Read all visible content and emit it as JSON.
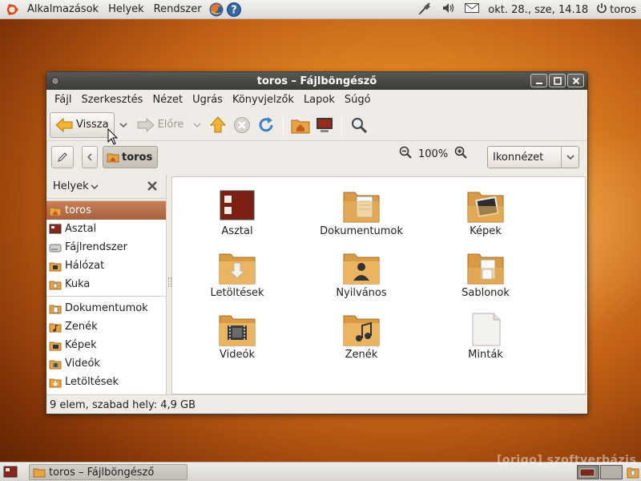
{
  "panel": {
    "menus": [
      "Alkalmazások",
      "Helyek",
      "Rendszer"
    ],
    "clock": "okt. 28., sze, 14.18",
    "user": "toros"
  },
  "window": {
    "title": "toros – Fájlböngésző",
    "menu": [
      "Fájl",
      "Szerkesztés",
      "Nézet",
      "Ugrás",
      "Könyvjelzők",
      "Lapok",
      "Súgó"
    ],
    "toolbar": {
      "back": "Vissza",
      "forward": "Előre"
    },
    "location": {
      "path": "toros",
      "zoom": "100%",
      "view": "Ikonnézet"
    },
    "sidebar": {
      "header": "Helyek",
      "places": [
        "toros",
        "Asztal",
        "Fájlrendszer",
        "Hálózat",
        "Kuka"
      ],
      "bookmarks": [
        "Dokumentumok",
        "Zenék",
        "Képek",
        "Videók",
        "Letöltések"
      ]
    },
    "files": [
      "Asztal",
      "Dokumentumok",
      "Képek",
      "Letöltések",
      "Nyilvános",
      "Sablonok",
      "Videók",
      "Zenék",
      "Minták"
    ],
    "status": "9 elem, szabad hely: 4,9 GB"
  },
  "taskbar": {
    "task": "toros – Fájlböngésző"
  },
  "watermark": "[origo] szoftverbázis"
}
